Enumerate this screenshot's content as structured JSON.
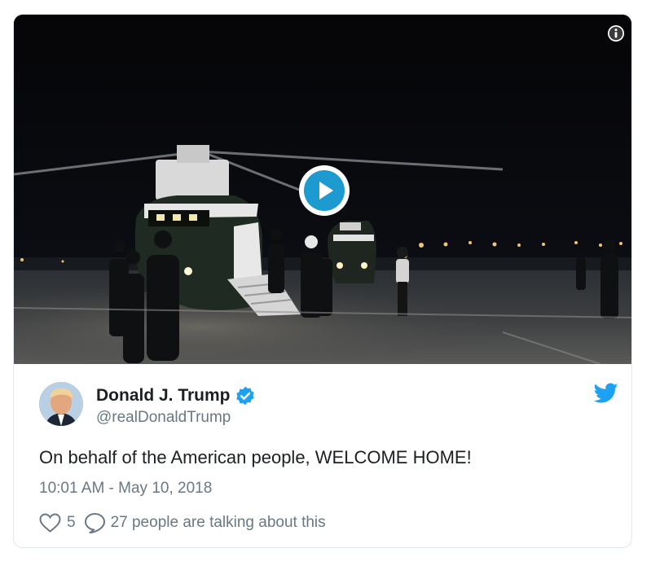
{
  "tweet": {
    "author_name": "Donald J. Trump",
    "handle": "@realDonaldTrump",
    "text": "On behalf of the American people, WELCOME HOME!",
    "timestamp": "10:01 AM - May 10, 2018",
    "like_count": "5",
    "conversation": "27 people are talking about this"
  },
  "icons": {
    "info": "info-icon",
    "play": "play-icon",
    "verified": "verified-badge-icon",
    "bird": "twitter-bird-icon",
    "like": "heart-icon",
    "reply": "speech-bubble-icon"
  },
  "colors": {
    "brand_blue": "#1da1f2",
    "play_blue": "#1d9bd1",
    "text_primary": "#1c2022",
    "text_secondary": "#697882",
    "border": "#e1e8ed"
  }
}
